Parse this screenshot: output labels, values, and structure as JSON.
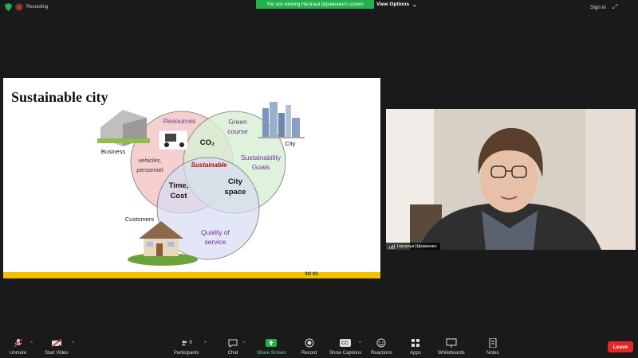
{
  "topbar": {
    "recording_label": "Recording",
    "viewing_banner": "You are viewing Наталья Шраменко's screen",
    "view_options_label": "View Options",
    "sign_in_label": "Sign in"
  },
  "slide": {
    "title": "Sustainable city",
    "labels": {
      "resources": "Resources",
      "green_course": "Green\ncourse",
      "city": "City",
      "business": "Business",
      "co2": "CO₂",
      "vehicles": "vehicles,\npersonnel",
      "sustainable": "Sustainable",
      "sustainability_goals": "Sustainability\nGoals",
      "time_cost": "Time,\nCost",
      "city_space": "City\nspace",
      "customers": "Customers",
      "quality": "Quality of\nservice"
    },
    "footer_logo": "ЗИ 03"
  },
  "video": {
    "participant_name": "Наталья Шраменко"
  },
  "toolbar": {
    "unmute": "Unmute",
    "start_video": "Start Video",
    "participants": "Participants",
    "participants_count": "9",
    "chat": "Chat",
    "share_screen": "Share Screen",
    "record": "Record",
    "show_captions": "Show Captions",
    "reactions": "Reactions",
    "apps": "Apps",
    "whiteboards": "Whiteboards",
    "notes": "Notes",
    "leave": "Leave"
  },
  "colors": {
    "banner_green": "#22b14c",
    "leave_red": "#e02828",
    "circle_red": "#f4c7c7",
    "circle_green": "#d7efd2",
    "circle_blue": "#d6dcf2",
    "footer_yellow": "#f2c200"
  }
}
